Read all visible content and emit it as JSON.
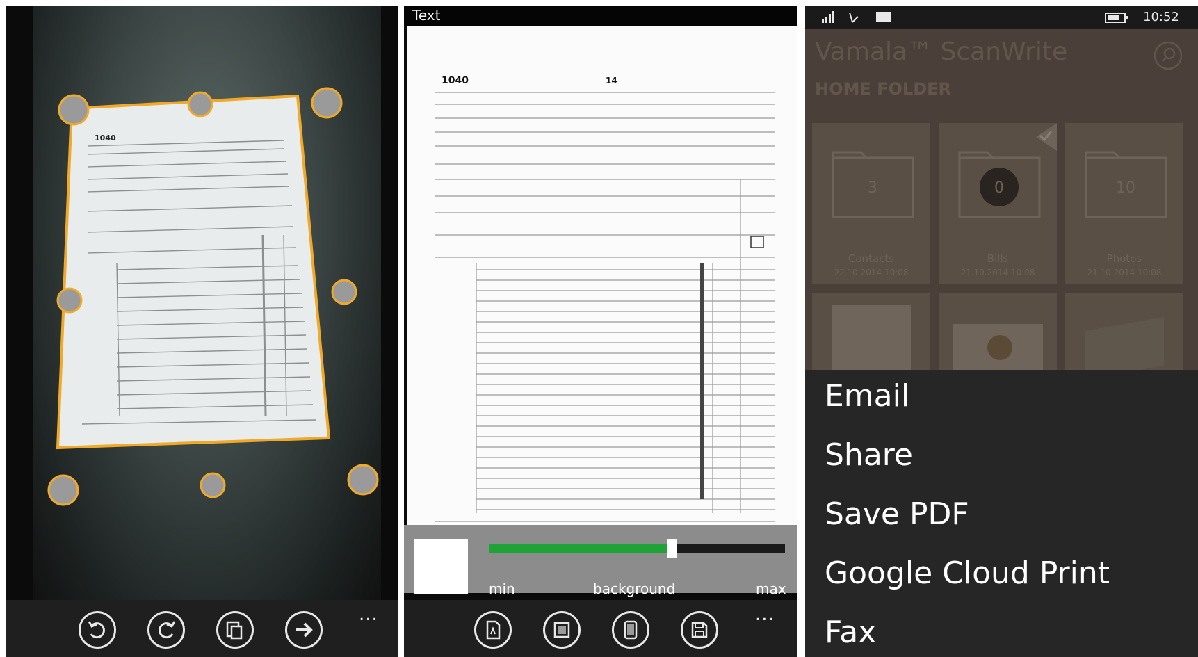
{
  "panel_crop": {
    "appbar": {
      "buttons": [
        {
          "name": "rotate-left-button",
          "icon": "rotate-left-icon"
        },
        {
          "name": "rotate-right-button",
          "icon": "rotate-right-icon"
        },
        {
          "name": "copy-pages-button",
          "icon": "copy-pages-icon"
        },
        {
          "name": "next-button",
          "icon": "arrow-right-icon"
        }
      ],
      "more": "..."
    }
  },
  "panel_enhance": {
    "title": "Text",
    "document": {
      "form_number": "1040",
      "form_year": "14"
    },
    "slider": {
      "min_label": "min",
      "center_label": "background",
      "max_label": "max",
      "value_percent": 62,
      "fill_color": "#1fa338"
    },
    "appbar": {
      "buttons": [
        {
          "name": "document-settings-button",
          "icon": "document-icon"
        },
        {
          "name": "color-mode-button",
          "icon": "color-mode-icon"
        },
        {
          "name": "contrast-button",
          "icon": "phone-icon"
        },
        {
          "name": "save-button",
          "icon": "floppy-disk-icon"
        }
      ],
      "more": "..."
    }
  },
  "panel_share": {
    "status_bar": {
      "time": "10:52"
    },
    "app_title": "Vamala™ ScanWrite",
    "folder_header": "HOME FOLDER",
    "folders": [
      {
        "name": "Contacts",
        "date": "22.10.2014 10:08",
        "count": "3"
      },
      {
        "name": "Bills",
        "date": "21.10.2014 10:08",
        "count": "0"
      },
      {
        "name": "Photos",
        "date": "21.10.2014 10:08",
        "count": "10"
      }
    ],
    "menu": [
      "Email",
      "Share",
      "Save PDF",
      "Google Cloud Print",
      "Fax"
    ],
    "accent": "#5a4f45"
  }
}
